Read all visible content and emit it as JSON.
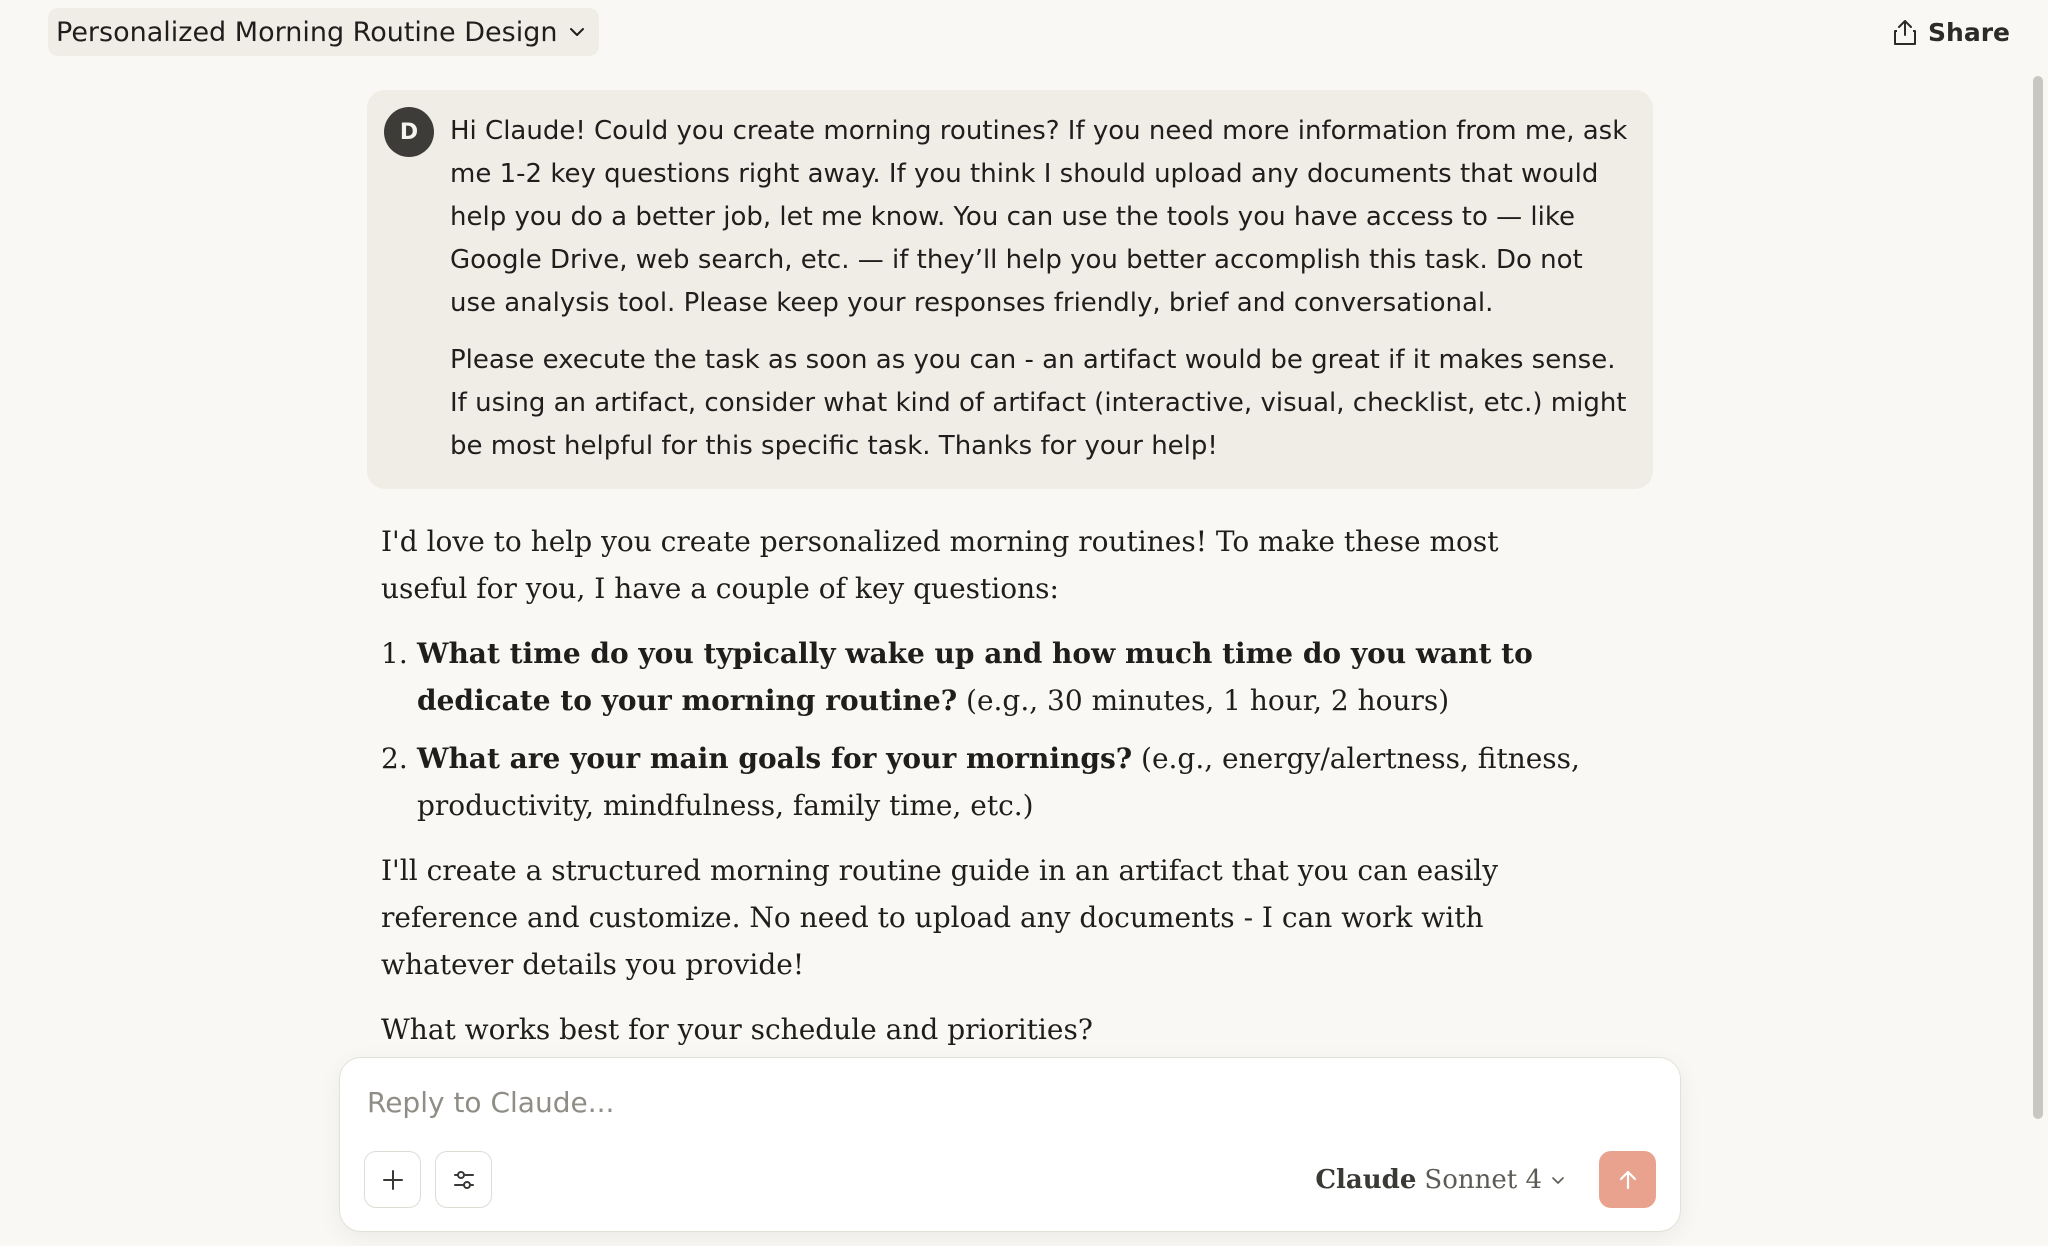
{
  "header": {
    "title": "Personalized Morning Routine Design",
    "share_label": "Share"
  },
  "user_message": {
    "avatar_initial": "D",
    "paragraphs": [
      "Hi Claude! Could you create morning routines? If you need more information from me, ask me 1-2 key questions right away. If you think I should upload any documents that would help you do a better job, let me know. You can use the tools you have access to — like Google Drive, web search, etc. — if they’ll help you better accomplish this task. Do not use analysis tool. Please keep your responses friendly, brief and conversational.",
      "Please execute the task as soon as you can - an artifact would be great if it makes sense. If using an artifact, consider what kind of artifact (interactive, visual, checklist, etc.) might be most helpful for this specific task. Thanks for your help!"
    ]
  },
  "assistant_message": {
    "intro": "I'd love to help you create personalized morning routines! To make these most useful for you, I have a couple of key questions:",
    "questions": [
      {
        "number": "1.",
        "bold": "What time do you typically wake up and how much time do you want to dedicate to your morning routine?",
        "rest": " (e.g., 30 minutes, 1 hour, 2 hours)"
      },
      {
        "number": "2.",
        "bold": "What are your main goals for your mornings?",
        "rest": " (e.g., energy/alertness, fitness, productivity, mindfulness, family time, etc.)"
      }
    ],
    "followup": "I'll create a structured morning routine guide in an artifact that you can easily reference and customize. No need to upload any documents - I can work with whatever details you provide!",
    "closing": "What works best for your schedule and priorities?"
  },
  "composer": {
    "placeholder": "Reply to Claude...",
    "value": "",
    "model_brand": "Claude",
    "model_version": "Sonnet 4"
  },
  "colors": {
    "background": "#f9f8f5",
    "user_bubble": "#efede6",
    "send_button": "#e8a28e"
  }
}
